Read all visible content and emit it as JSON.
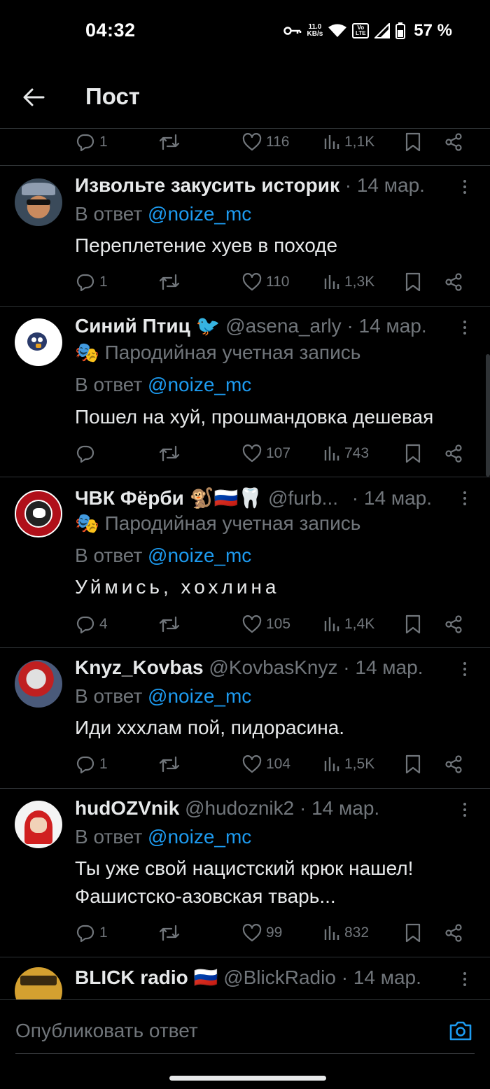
{
  "status_bar": {
    "time": "04:32",
    "net_speed_top": "11.0",
    "net_speed_bottom": "KB/s",
    "volte": "Vo LTE",
    "battery": "57 %"
  },
  "header": {
    "title": "Пост"
  },
  "top_actions": {
    "replies": "1",
    "likes": "116",
    "views": "1,1K"
  },
  "tweets": [
    {
      "name": "Извольте закусить историк",
      "handle": "",
      "date": "· 14 мар.",
      "parody": "",
      "reply_prefix": "В ответ",
      "mention": "@noize_mc",
      "text": "Переплетение хуев в походе",
      "text2": "",
      "replies": "1",
      "likes": "110",
      "views": "1,3K"
    },
    {
      "name": "Синий Птиц 🐦",
      "handle": "@asena_arly",
      "date": "· 14 мар.",
      "parody": "🎭 Пародийная учетная запись",
      "reply_prefix": "В ответ",
      "mention": "@noize_mc",
      "text": "Пошел на хуй, прошмандовка дешевая",
      "text2": "",
      "replies": "",
      "likes": "107",
      "views": "743"
    },
    {
      "name": "ЧВК Фёрби 🐒🇷🇺🦷",
      "handle": "@furb...",
      "date": "· 14 мар.",
      "parody": "🎭 Пародийная учетная запись",
      "reply_prefix": "В ответ",
      "mention": "@noize_mc",
      "text": "Уймись, хохлина",
      "text2": "",
      "replies": "4",
      "likes": "105",
      "views": "1,4K"
    },
    {
      "name": "Knyz_Kovbas",
      "handle": "@KovbasKnyz",
      "date": "· 14 мар.",
      "parody": "",
      "reply_prefix": "В ответ",
      "mention": "@noize_mc",
      "text": "Иди хххлам пой, пидорасина.",
      "text2": "",
      "replies": "1",
      "likes": "104",
      "views": "1,5K"
    },
    {
      "name": "hudOZVnik",
      "handle": "@hudoznik2",
      "date": "· 14 мар.",
      "parody": "",
      "reply_prefix": "В ответ",
      "mention": "@noize_mc",
      "text": "Ты уже свой нацистский крюк нашел!",
      "text2": "Фашистско-азовская тварь...",
      "replies": "1",
      "likes": "99",
      "views": "832"
    },
    {
      "name": "BLICK radio 🇷🇺",
      "handle": "@BlickRadio",
      "date": "· 14 мар.",
      "parody": "",
      "reply_prefix": "",
      "mention": "",
      "text": "",
      "text2": "",
      "replies": "",
      "likes": "",
      "views": ""
    }
  ],
  "composer": {
    "placeholder": "Опубликовать ответ"
  },
  "colors": {
    "accent": "#1d9bf0",
    "muted": "#71767b",
    "text": "#e7e9ea",
    "divider": "#2f3336",
    "background": "#000000"
  }
}
